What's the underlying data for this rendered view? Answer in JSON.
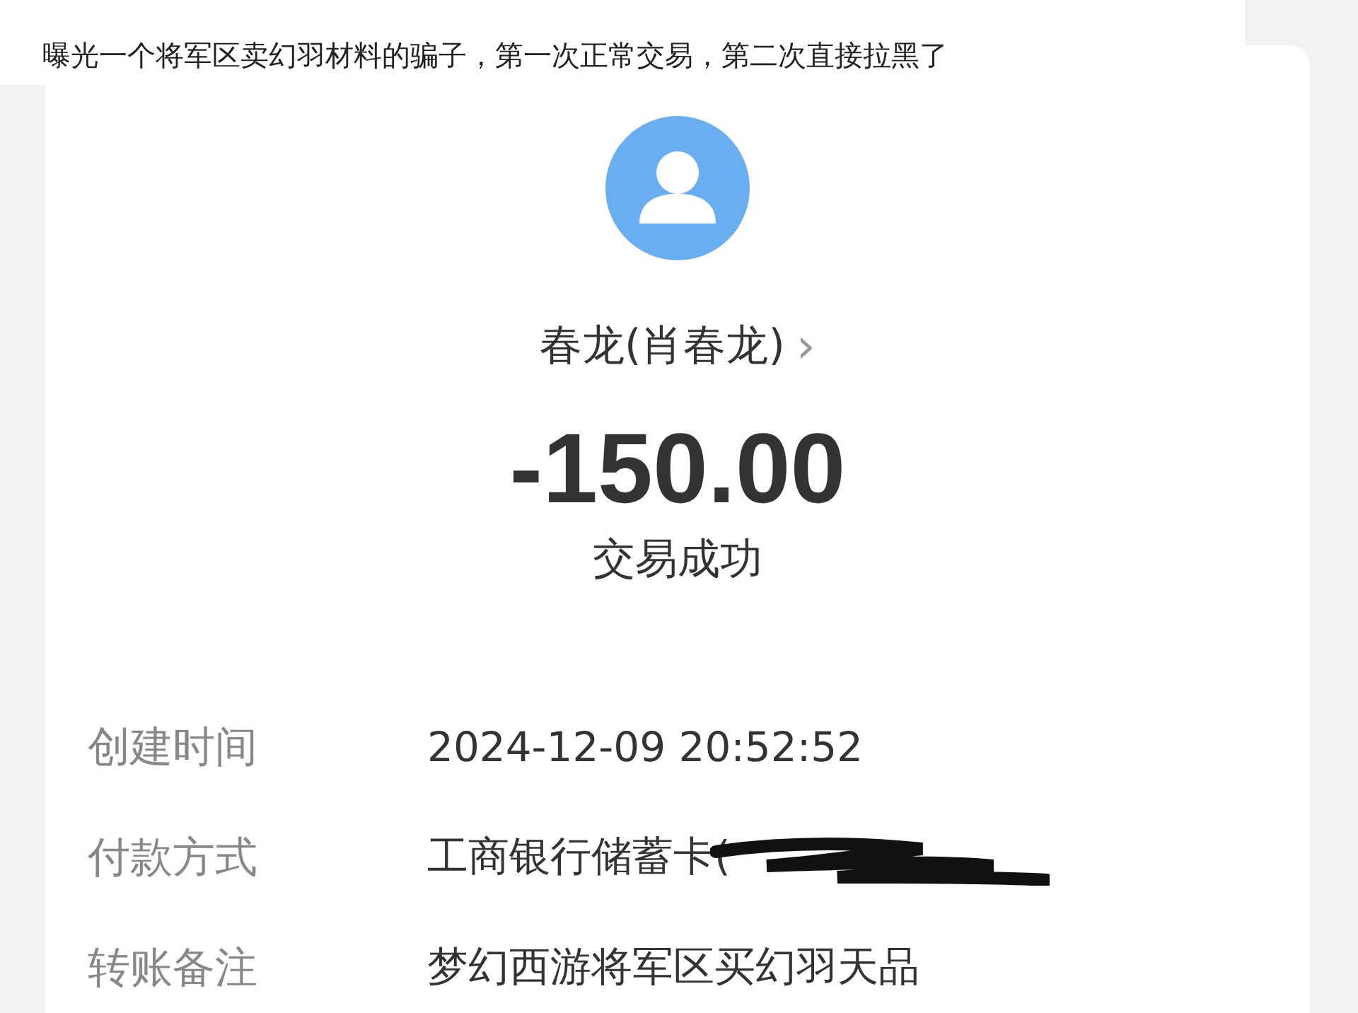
{
  "caption": "曝光一个将军区卖幻羽材料的骗子，第一次正常交易，第二次直接拉黑了",
  "payee": {
    "name": "春龙(肖春龙)",
    "chevron": "›"
  },
  "amount": "-150.00",
  "status": "交易成功",
  "details": [
    {
      "label": "创建时间",
      "value": "2024-12-09 20:52:52",
      "redacted": false
    },
    {
      "label": "付款方式",
      "value": "工商银行储蓄卡(",
      "redacted": true
    },
    {
      "label": "转账备注",
      "value": "梦幻西游将军区买幻羽天品",
      "redacted": false
    }
  ]
}
